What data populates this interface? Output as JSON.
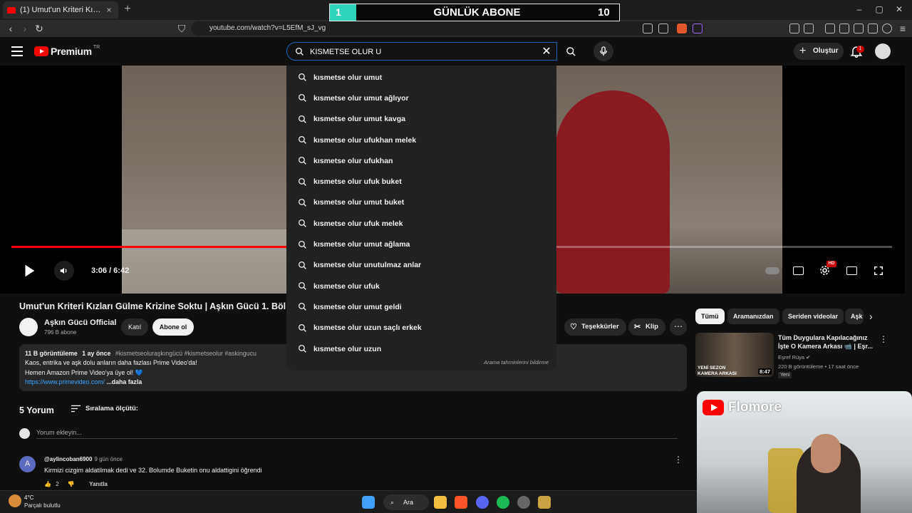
{
  "browser": {
    "tab_title": "(1) Umut'un Kriteri Kızları Gülme",
    "tab_close": "×",
    "new_tab": "+",
    "url": "youtube.com/watch?v=L5EfM_sJ_vg",
    "win_min": "–",
    "win_max": "▢",
    "win_close": "✕"
  },
  "overlay_counter": {
    "left": "1",
    "label": "GÜNLÜK ABONE",
    "right": "10",
    "accent": "#2fd4b9"
  },
  "header": {
    "logo_text": "Premium",
    "logo_region": "TR",
    "search_query": "KISMETSE OLUR U",
    "clear": "✕",
    "create_label": "Oluştur",
    "create_plus": "+",
    "notifications_count": "1"
  },
  "suggestions": {
    "items": [
      "kısmetse olur umut",
      "kısmetse olur umut ağlıyor",
      "kısmetse olur umut kavga",
      "kısmetse olur ufukhan melek",
      "kısmetse olur ufukhan",
      "kısmetse olur ufuk buket",
      "kısmetse olur umut buket",
      "kısmetse olur ufuk melek",
      "kısmetse olur umut ağlama",
      "kısmetse olur unutulmaz anlar",
      "kısmetse olur ufuk",
      "kısmetse olur umut geldi",
      "kısmetse olur uzun saçlı erkek",
      "kısmetse olur uzun"
    ],
    "report_label": "Arama tahminlerini bildirme"
  },
  "player": {
    "time": "3:06 / 6:42",
    "progress_fraction": 0.47,
    "hd_badge": "HD"
  },
  "video": {
    "title": "Umut'un Kriteri Kızları Gülme Krizine Soktu | Aşkın Gücü 1. Böl",
    "channel": "Aşkın Gücü Official",
    "subscribers": "796 B abone",
    "join_label": "Katıl",
    "subscribe_label": "Abone ol",
    "thanks_label": "Teşekkürler",
    "clip_label": "Klip",
    "more": "⋯"
  },
  "description": {
    "views": "11 B görüntüleme",
    "age": "1 ay önce",
    "hashtags": "#kismetseolurаşkıngücü #kismetseolur #askingucu",
    "line1": "Kaos, entrika ve aşk dolu anların daha fazlası Prime Video'da!",
    "line2": "Hemen Amazon Prime Video'ya üye ol! 💙",
    "link": "https://www.primevideo.com/",
    "more": "...daha fazla"
  },
  "comments": {
    "count_label": "5 Yorum",
    "sort_label": "Sıralama ölçütü:",
    "add_placeholder": "Yorum ekleyin...",
    "first": {
      "avatar_letter": "A",
      "user": "@aylincoban6900",
      "ago": "9 gün önce",
      "text": "Kirmizi cizgim aldatilmak dedi ve 32. Bolumde Buketin onu aldattigini öğrendi",
      "likes": "2",
      "reply": "Yanıtla"
    }
  },
  "sidebar": {
    "chips": [
      "Tümü",
      "Aramanızdan",
      "Seriden videolar",
      "Aşk"
    ],
    "next": "›",
    "rec": {
      "title": "Tüm Duygulara Kapılacağınız İşte O Kamera Arkası 📹 | Eşr...",
      "channel": "Eşref Rüya ✔",
      "meta": "220 B görüntüleme • 17 saat önce",
      "badge": "Yeni",
      "duration": "8:47",
      "thumb_label1": "YENİ SEZON",
      "thumb_label2": "KAMERA ARKASI"
    }
  },
  "webcam": {
    "brand": "Flomore"
  },
  "taskbar": {
    "temp": "4°C",
    "weather": "Parçalı bulutlu",
    "search_label": "Ara"
  }
}
